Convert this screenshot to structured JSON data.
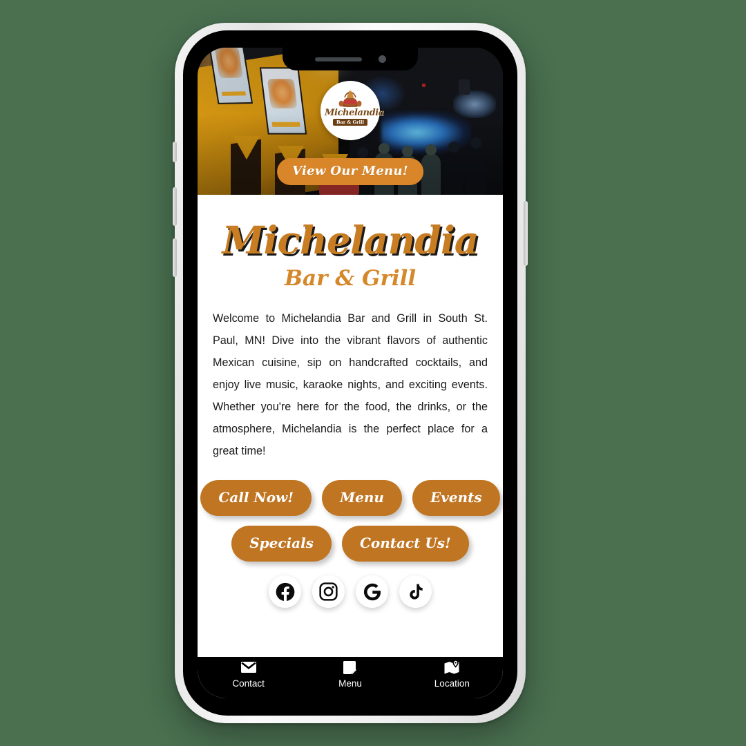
{
  "page": {
    "background_color": "#4a7050",
    "device": "smartphone-mockup"
  },
  "theme": {
    "accent_orange": "#c07522",
    "hero_button_orange": "#d9862a",
    "title_orange": "#c87d22",
    "subtitle_orange": "#d4882a",
    "text_color": "#1a1a1a",
    "nav_background": "#000000",
    "card_background": "#ffffff"
  },
  "hero": {
    "logo": {
      "name": "Michelandia",
      "tagline": "Bar & Grill",
      "alt": "michelandia-logo"
    },
    "cta_label": "View Our Menu!"
  },
  "main": {
    "title": "Michelandia",
    "subtitle": "Bar & Grill",
    "about": "Welcome to Michelandia Bar and Grill in South St. Paul, MN! Dive into the vibrant flavors of authentic Mexican cuisine, sip on handcrafted cocktails, and enjoy live music, karaoke nights, and exciting events. Whether you're here for the food, the drinks, or the atmosphere, Michelandia is the perfect place for a great time!",
    "action_rows": [
      [
        {
          "label": "Call Now!",
          "name": "call-now-button"
        },
        {
          "label": "Menu",
          "name": "menu-button"
        },
        {
          "label": "Events",
          "name": "events-button"
        }
      ],
      [
        {
          "label": "Specials",
          "name": "specials-button"
        },
        {
          "label": "Contact Us!",
          "name": "contact-us-button"
        }
      ]
    ],
    "social_links": [
      {
        "icon": "facebook-icon",
        "label": "Facebook"
      },
      {
        "icon": "instagram-icon",
        "label": "Instagram"
      },
      {
        "icon": "google-icon",
        "label": "Google"
      },
      {
        "icon": "tiktok-icon",
        "label": "TikTok"
      }
    ]
  },
  "bottom_nav": {
    "items": [
      {
        "label": "Contact",
        "icon": "envelope-icon"
      },
      {
        "label": "Menu",
        "icon": "book-icon"
      },
      {
        "label": "Location",
        "icon": "map-pin-icon"
      }
    ]
  }
}
